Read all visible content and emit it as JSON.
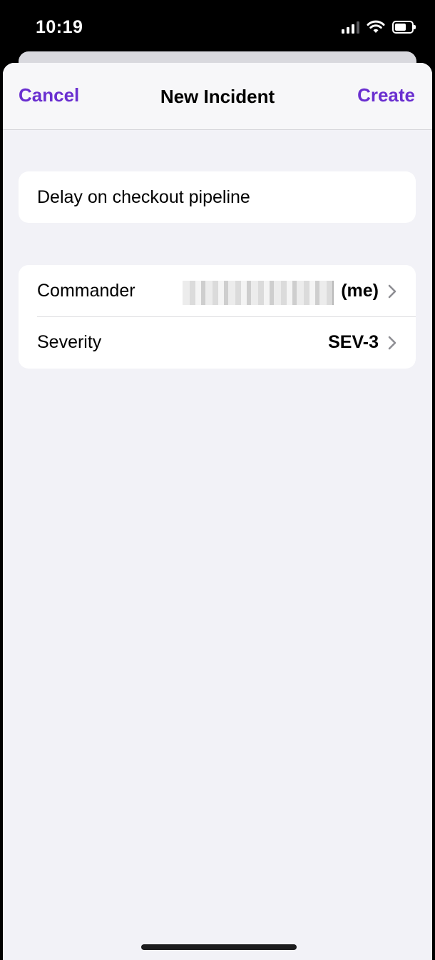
{
  "status_bar": {
    "time": "10:19",
    "icons": [
      "cellular-signal-icon",
      "wifi-icon",
      "battery-icon"
    ]
  },
  "nav": {
    "cancel_label": "Cancel",
    "title": "New Incident",
    "create_label": "Create"
  },
  "form": {
    "incident_name": "Delay on checkout pipeline"
  },
  "settings": {
    "commander_label": "Commander",
    "commander_value_suffix": "(me)",
    "severity_label": "Severity",
    "severity_value": "SEV-3"
  },
  "colors": {
    "accent": "#6a2fd0",
    "background": "#f2f2f7",
    "card": "#ffffff"
  }
}
